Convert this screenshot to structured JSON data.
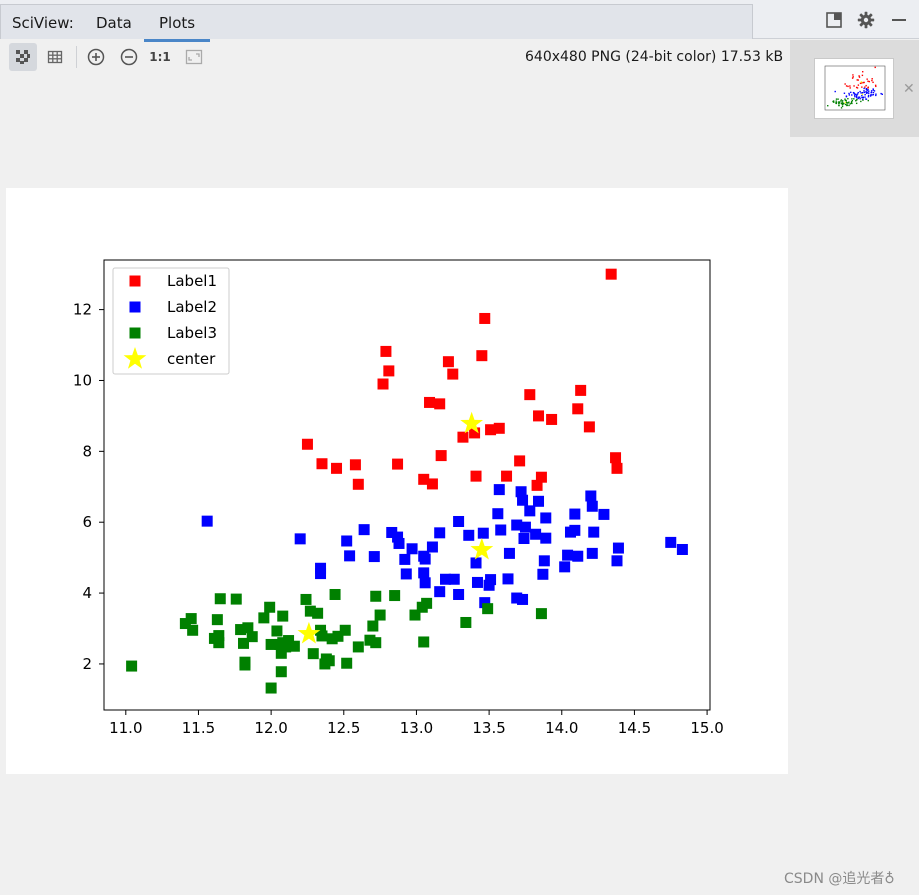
{
  "header": {
    "app_label": "SciView:",
    "tabs": [
      {
        "label": "Data"
      },
      {
        "label": "Plots"
      }
    ],
    "active_tab": "Plots"
  },
  "toolbar": {
    "zoom_reset_label": "1:1",
    "image_info": "640x480 PNG (24-bit color) 17.53 kB"
  },
  "icons": {
    "checker": "checkerboard-icon",
    "grid": "grid-icon",
    "zoom_in": "zoom-in-icon",
    "zoom_out": "zoom-out-icon",
    "fit": "fit-window-icon",
    "restore": "restore-window-icon",
    "settings": "gear-icon",
    "minimize": "minimize-icon",
    "close": "close-icon"
  },
  "colors": {
    "accent": "#4a86c8"
  },
  "watermark": "CSDN @追光者♁",
  "chart_data": {
    "type": "scatter",
    "title": "",
    "xlabel": "",
    "ylabel": "",
    "xlim": [
      10.85,
      15.02
    ],
    "ylim": [
      0.7,
      13.4
    ],
    "xticks": [
      11.0,
      11.5,
      12.0,
      12.5,
      13.0,
      13.5,
      14.0,
      14.5,
      15.0
    ],
    "xtick_labels": [
      "11.0",
      "11.5",
      "12.0",
      "12.5",
      "13.0",
      "13.5",
      "14.0",
      "14.5",
      "15.0"
    ],
    "yticks": [
      2,
      4,
      6,
      8,
      10,
      12
    ],
    "ytick_labels": [
      "2",
      "4",
      "6",
      "8",
      "10",
      "12"
    ],
    "grid": false,
    "legend": "top-left",
    "series": [
      {
        "name": "Label1",
        "color": "#ff0000",
        "marker": "square",
        "points": [
          [
            14.34,
            13.0
          ],
          [
            13.47,
            11.75
          ],
          [
            13.22,
            10.53
          ],
          [
            12.79,
            10.82
          ],
          [
            12.81,
            10.27
          ],
          [
            12.77,
            9.9
          ],
          [
            13.45,
            10.7
          ],
          [
            13.25,
            10.18
          ],
          [
            13.09,
            9.38
          ],
          [
            13.16,
            9.34
          ],
          [
            13.78,
            9.6
          ],
          [
            14.13,
            9.72
          ],
          [
            14.11,
            9.2
          ],
          [
            13.84,
            9.0
          ],
          [
            13.93,
            8.9
          ],
          [
            14.19,
            8.69
          ],
          [
            13.51,
            8.61
          ],
          [
            13.57,
            8.65
          ],
          [
            13.32,
            8.4
          ],
          [
            13.4,
            8.52
          ],
          [
            12.25,
            8.2
          ],
          [
            14.37,
            7.82
          ],
          [
            14.38,
            7.52
          ],
          [
            12.35,
            7.65
          ],
          [
            12.45,
            7.52
          ],
          [
            12.58,
            7.62
          ],
          [
            12.87,
            7.64
          ],
          [
            13.17,
            7.88
          ],
          [
            13.71,
            7.73
          ],
          [
            13.62,
            7.3
          ],
          [
            13.41,
            7.3
          ],
          [
            13.05,
            7.21
          ],
          [
            13.11,
            7.08
          ],
          [
            12.6,
            7.07
          ],
          [
            13.86,
            7.27
          ],
          [
            13.83,
            7.04
          ]
        ]
      },
      {
        "name": "Label2",
        "color": "#0000ff",
        "marker": "square",
        "points": [
          [
            11.56,
            6.03
          ],
          [
            12.2,
            5.53
          ],
          [
            12.34,
            4.7
          ],
          [
            12.34,
            4.55
          ],
          [
            12.52,
            5.47
          ],
          [
            12.54,
            5.05
          ],
          [
            12.64,
            5.79
          ],
          [
            12.71,
            5.03
          ],
          [
            12.83,
            5.71
          ],
          [
            12.87,
            5.58
          ],
          [
            12.88,
            5.4
          ],
          [
            12.92,
            4.95
          ],
          [
            12.93,
            4.54
          ],
          [
            12.97,
            5.25
          ],
          [
            13.05,
            5.04
          ],
          [
            13.06,
            4.96
          ],
          [
            13.05,
            4.57
          ],
          [
            13.06,
            4.29
          ],
          [
            13.11,
            5.3
          ],
          [
            13.16,
            5.7
          ],
          [
            13.16,
            4.04
          ],
          [
            13.2,
            4.39
          ],
          [
            13.26,
            4.39
          ],
          [
            13.29,
            6.02
          ],
          [
            13.29,
            3.96
          ],
          [
            13.36,
            5.63
          ],
          [
            13.41,
            4.85
          ],
          [
            13.42,
            4.3
          ],
          [
            13.46,
            5.69
          ],
          [
            13.47,
            3.73
          ],
          [
            13.5,
            4.22
          ],
          [
            13.51,
            4.38
          ],
          [
            13.56,
            6.24
          ],
          [
            13.57,
            6.92
          ],
          [
            13.58,
            5.78
          ],
          [
            13.63,
            4.4
          ],
          [
            13.64,
            5.12
          ],
          [
            13.69,
            3.86
          ],
          [
            13.69,
            5.92
          ],
          [
            13.72,
            6.86
          ],
          [
            13.73,
            3.82
          ],
          [
            13.73,
            6.62
          ],
          [
            13.74,
            5.54
          ],
          [
            13.75,
            5.86
          ],
          [
            13.78,
            6.32
          ],
          [
            13.82,
            5.66
          ],
          [
            13.84,
            6.59
          ],
          [
            13.87,
            4.53
          ],
          [
            13.89,
            5.55
          ],
          [
            13.89,
            6.12
          ],
          [
            13.88,
            4.91
          ],
          [
            14.02,
            4.74
          ],
          [
            14.04,
            5.07
          ],
          [
            14.06,
            5.72
          ],
          [
            14.09,
            6.23
          ],
          [
            14.09,
            5.77
          ],
          [
            14.11,
            5.04
          ],
          [
            14.2,
            6.74
          ],
          [
            14.21,
            6.45
          ],
          [
            14.21,
            5.12
          ],
          [
            14.22,
            5.72
          ],
          [
            14.29,
            6.22
          ],
          [
            14.38,
            4.91
          ],
          [
            14.39,
            5.27
          ],
          [
            14.75,
            5.43
          ],
          [
            14.83,
            5.23
          ]
        ]
      },
      {
        "name": "Label3",
        "color": "#008000",
        "marker": "square",
        "points": [
          [
            11.04,
            1.94
          ],
          [
            11.41,
            3.14
          ],
          [
            11.45,
            3.28
          ],
          [
            11.46,
            2.95
          ],
          [
            11.61,
            2.72
          ],
          [
            11.63,
            3.25
          ],
          [
            11.64,
            2.8
          ],
          [
            11.65,
            3.84
          ],
          [
            11.64,
            2.6
          ],
          [
            11.76,
            3.83
          ],
          [
            11.79,
            2.97
          ],
          [
            11.81,
            2.58
          ],
          [
            11.82,
            2.05
          ],
          [
            11.82,
            1.97
          ],
          [
            11.84,
            3.02
          ],
          [
            11.87,
            2.77
          ],
          [
            11.95,
            3.3
          ],
          [
            11.99,
            3.6
          ],
          [
            12.0,
            2.55
          ],
          [
            12.0,
            1.32
          ],
          [
            12.04,
            2.93
          ],
          [
            12.06,
            2.55
          ],
          [
            12.07,
            2.3
          ],
          [
            12.08,
            3.35
          ],
          [
            12.07,
            1.78
          ],
          [
            12.08,
            2.6
          ],
          [
            12.1,
            2.48
          ],
          [
            12.12,
            2.66
          ],
          [
            12.16,
            2.5
          ],
          [
            12.24,
            3.82
          ],
          [
            12.27,
            3.49
          ],
          [
            12.29,
            2.29
          ],
          [
            12.32,
            3.43
          ],
          [
            12.34,
            2.95
          ],
          [
            12.35,
            2.79
          ],
          [
            12.37,
            2.0
          ],
          [
            12.38,
            2.14
          ],
          [
            12.4,
            2.09
          ],
          [
            12.42,
            2.71
          ],
          [
            12.44,
            3.96
          ],
          [
            12.46,
            2.78
          ],
          [
            12.51,
            2.95
          ],
          [
            12.52,
            2.02
          ],
          [
            12.6,
            2.48
          ],
          [
            12.68,
            2.67
          ],
          [
            12.7,
            3.07
          ],
          [
            12.72,
            2.6
          ],
          [
            12.72,
            3.91
          ],
          [
            12.75,
            3.38
          ],
          [
            12.85,
            3.93
          ],
          [
            12.99,
            3.38
          ],
          [
            13.04,
            3.6
          ],
          [
            13.07,
            3.71
          ],
          [
            13.05,
            2.62
          ],
          [
            13.34,
            3.17
          ],
          [
            13.49,
            3.56
          ],
          [
            13.86,
            3.42
          ]
        ]
      },
      {
        "name": "center",
        "color": "#ffff00",
        "marker": "star",
        "points": [
          [
            13.38,
            8.78
          ],
          [
            13.45,
            5.22
          ],
          [
            12.26,
            2.85
          ]
        ]
      }
    ]
  }
}
